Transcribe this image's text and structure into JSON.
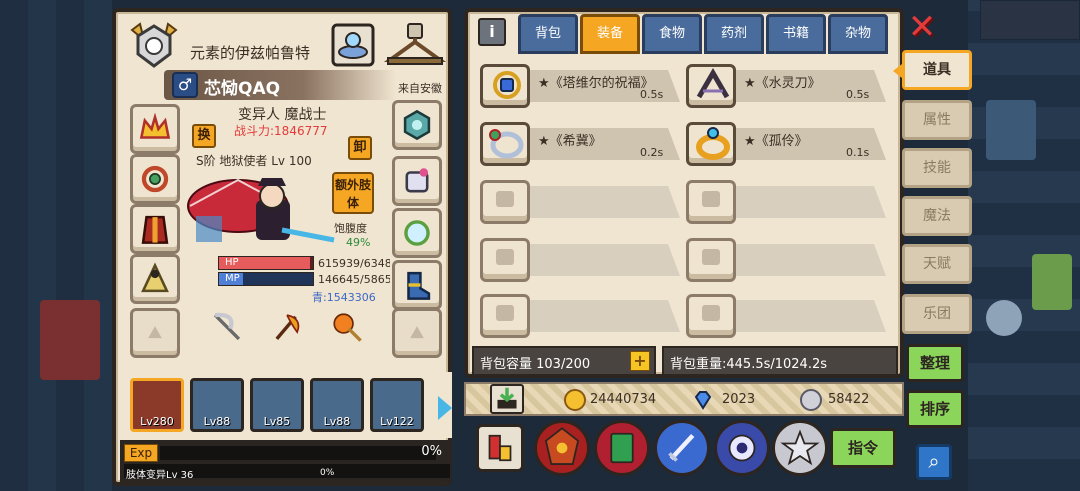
{
  "character": {
    "title": "元素的伊兹帕鲁特",
    "name": "芯恸QAQ",
    "gender_symbol": "♂",
    "origin": "来自安徽",
    "class_name": "变异人 魔战士",
    "power": "战斗力:1846777",
    "rank": "S阶 地狱使者 Lv 100",
    "swap_label": "换",
    "unequip_label": "卸",
    "extra_limb_label": "额外肢体",
    "satiety_label": "饱腹度",
    "satiety_value": "49%",
    "hp_label": "HP",
    "hp_text": "615939/6348",
    "hp_fill": 0.97,
    "mp_label": "MP",
    "mp_text": "146645/5865",
    "mp_fill": 0.25,
    "blue_stat": "青:1543306"
  },
  "party": [
    {
      "level": "Lv280",
      "selected": true
    },
    {
      "level": "Lv88"
    },
    {
      "level": "Lv85"
    },
    {
      "level": "Lv88"
    },
    {
      "level": "Lv122"
    }
  ],
  "exp": {
    "badge": "Exp",
    "percent": "0%",
    "limb_label": "肢体变异Lv 36",
    "limb_percent": "0%"
  },
  "inventory": {
    "info_label": "i",
    "tabs": [
      "背包",
      "装备",
      "食物",
      "药剂",
      "书籍",
      "杂物"
    ],
    "active_tab": "装备",
    "items": [
      {
        "name": "★《塔维尔的祝福》",
        "weight": "0.5s",
        "icon": "blue-amulet-icon"
      },
      {
        "name": "★《水灵刀》",
        "weight": "0.5s",
        "icon": "dark-blade-icon"
      },
      {
        "name": "★《希冀》",
        "weight": "0.2s",
        "icon": "silver-ring-icon"
      },
      {
        "name": "★《孤伶》",
        "weight": "0.1s",
        "icon": "gold-ring-icon"
      }
    ],
    "capacity": "背包容量 103/200",
    "capacity_plus": "+",
    "weight": "背包重量:445.5s/1024.2s"
  },
  "currency": {
    "gold": "24440734",
    "diamond": "2023",
    "silver": "58422"
  },
  "side_tabs": [
    "道具",
    "属性",
    "技能",
    "魔法",
    "天赋",
    "乐团"
  ],
  "active_side_tab": "道具",
  "buttons": {
    "close": "✕",
    "organize": "整理",
    "sort": "排序",
    "command": "指令",
    "search": "⌕"
  },
  "colors": {
    "accent": "#f5a623",
    "tab_blue": "#4a6c9c",
    "hp": "#e65b5b",
    "mp": "#4f7fd6",
    "power_red": "#e23b3b",
    "satiety_green": "#2c8a3a",
    "close_red": "#e23b3b",
    "button_green": "#8bd65a"
  }
}
